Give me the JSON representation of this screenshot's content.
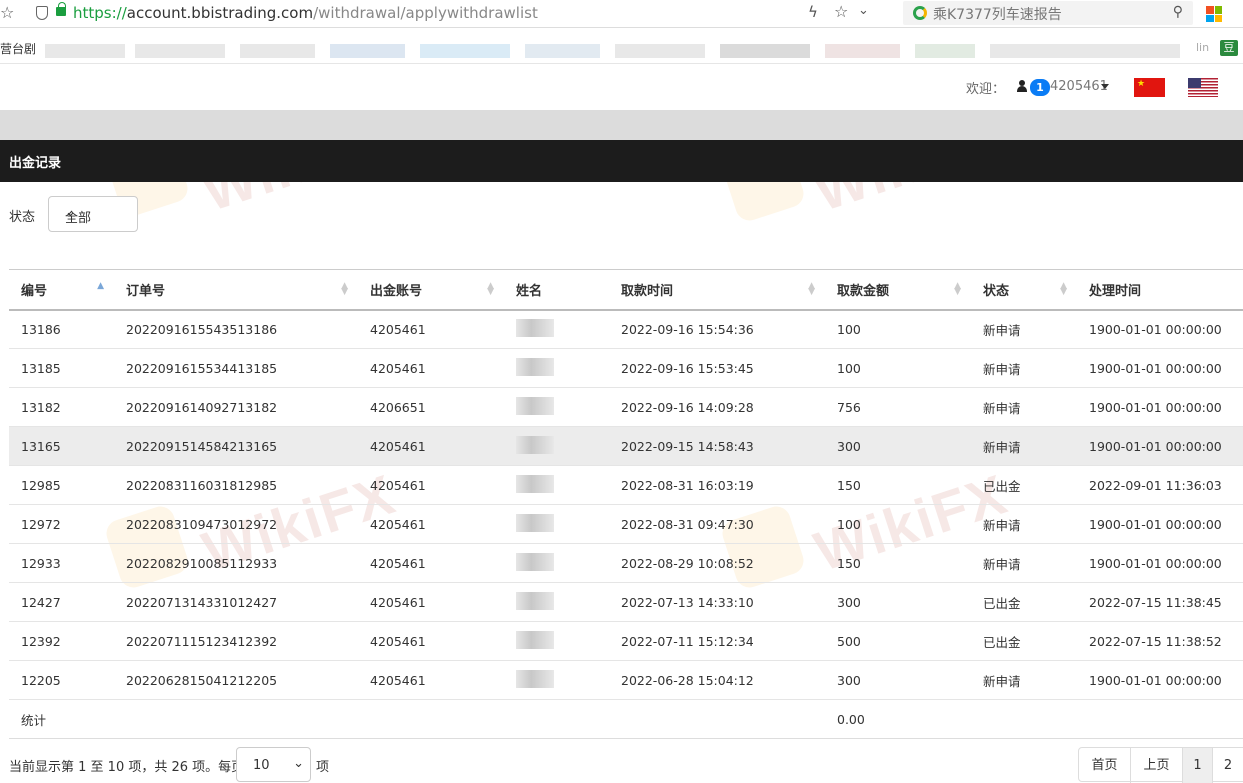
{
  "browser": {
    "url_proto": "https://",
    "url_host": "account.bbistrading.com",
    "url_path": "/withdrawal/applywithdrawlist",
    "search_text": "乘K7377列车速报告",
    "bookmark_prefix": "营台剧",
    "bookmark_suffix": "lin",
    "bookmark_icon_text": "豆"
  },
  "header": {
    "welcome": "欢迎：",
    "badge": "1",
    "account": "4205461"
  },
  "page": {
    "title": "出金记录",
    "filter_label": "状态",
    "filter_value": "全部"
  },
  "table": {
    "headers": [
      "编号",
      "订单号",
      "出金账号",
      "姓名",
      "取款时间",
      "取款金额",
      "状态",
      "处理时间"
    ],
    "rows": [
      [
        "13186",
        "2022091615543513186",
        "4205461",
        "",
        "2022-09-16 15:54:36",
        "100",
        "新申请",
        "1900-01-01 00:00:00"
      ],
      [
        "13185",
        "2022091615534413185",
        "4205461",
        "",
        "2022-09-16 15:53:45",
        "100",
        "新申请",
        "1900-01-01 00:00:00"
      ],
      [
        "13182",
        "2022091614092713182",
        "4206651",
        "",
        "2022-09-16 14:09:28",
        "756",
        "新申请",
        "1900-01-01 00:00:00"
      ],
      [
        "13165",
        "2022091514584213165",
        "4205461",
        "",
        "2022-09-15 14:58:43",
        "300",
        "新申请",
        "1900-01-01 00:00:00"
      ],
      [
        "12985",
        "2022083116031812985",
        "4205461",
        "",
        "2022-08-31 16:03:19",
        "150",
        "已出金",
        "2022-09-01 11:36:03"
      ],
      [
        "12972",
        "2022083109473012972",
        "4205461",
        "",
        "2022-08-31 09:47:30",
        "100",
        "新申请",
        "1900-01-01 00:00:00"
      ],
      [
        "12933",
        "2022082910085112933",
        "4205461",
        "",
        "2022-08-29 10:08:52",
        "150",
        "新申请",
        "1900-01-01 00:00:00"
      ],
      [
        "12427",
        "2022071314331012427",
        "4205461",
        "",
        "2022-07-13 14:33:10",
        "300",
        "已出金",
        "2022-07-15 11:38:45"
      ],
      [
        "12392",
        "2022071115123412392",
        "4205461",
        "",
        "2022-07-11 15:12:34",
        "500",
        "已出金",
        "2022-07-15 11:38:52"
      ],
      [
        "12205",
        "2022062815041212205",
        "4205461",
        "",
        "2022-06-28 15:04:12",
        "300",
        "新申请",
        "1900-01-01 00:00:00"
      ]
    ],
    "total_label": "统计",
    "total_amount": "0.00"
  },
  "footer": {
    "info": "当前显示第 1 至 10 项，共 26 项。每页",
    "page_size": "10",
    "suffix": "项",
    "first": "首页",
    "prev": "上页",
    "page1": "1",
    "page2": "2"
  },
  "watermark": "WikiFX"
}
